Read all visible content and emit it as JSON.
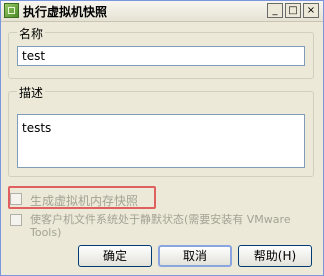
{
  "window": {
    "title": "执行虚拟机快照",
    "controls": {
      "minimize": "_",
      "maximize": "□",
      "close": "×"
    }
  },
  "name_group": {
    "label": "名称",
    "value": "test"
  },
  "description_group": {
    "label": "描述",
    "value": "tests"
  },
  "options": {
    "snapshot_memory": {
      "label": "生成虚拟机内存快照",
      "checked": false,
      "enabled": false
    },
    "quiesce_fs": {
      "label": "使客户机文件系统处于静默状态(需要安装有 VMware Tools)",
      "checked": false,
      "enabled": false
    }
  },
  "buttons": {
    "ok": "确定",
    "cancel": "取消",
    "help": "帮助(H)"
  },
  "colors": {
    "highlight": "#e06060",
    "window_bg": "#ece9d8"
  }
}
